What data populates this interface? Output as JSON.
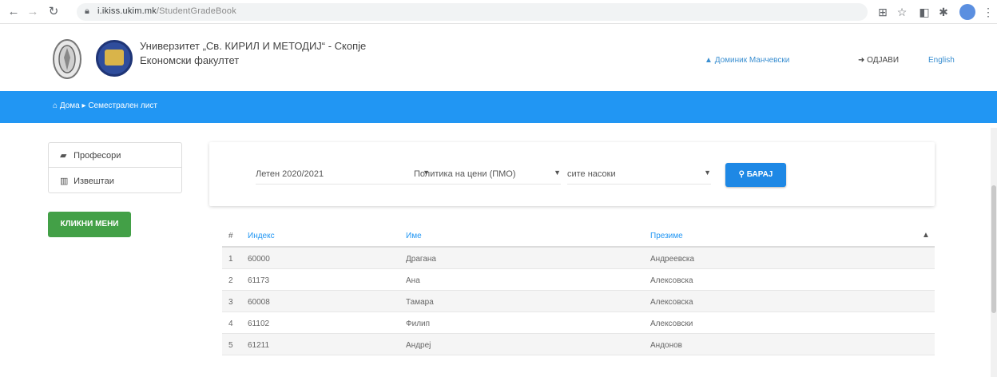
{
  "browser": {
    "url_host": "i.ikiss.ukim.mk",
    "url_path": "/StudentGradeBook"
  },
  "header": {
    "university": "Универзитет „Св. КИРИЛ И МЕТОДИЈ“ - Скопје",
    "faculty": "Економски факултет",
    "user": "Доминик Манчевски",
    "logout": "ОДЈАВИ",
    "language": "English"
  },
  "nav": {
    "home": "Дома",
    "current": "Семестрален лист"
  },
  "sidebar": {
    "items": [
      {
        "label": "Професори"
      },
      {
        "label": "Извештаи"
      }
    ],
    "green_button": "КЛИКНИ МЕНИ"
  },
  "filters": {
    "year": "Летен 2020/2021",
    "subject": "Политика на цени (ПМО)",
    "direction": "сите насоки",
    "search_button": "БАРАЈ"
  },
  "table": {
    "headers": {
      "num": "#",
      "index": "Индекс",
      "name": "Име",
      "surname": "Презиме"
    },
    "rows": [
      {
        "num": "1",
        "index": "60000",
        "name": "Драгана",
        "surname": "Андреевска"
      },
      {
        "num": "2",
        "index": "61173",
        "name": "Ана",
        "surname": "Алексовска"
      },
      {
        "num": "3",
        "index": "60008",
        "name": "Тамара",
        "surname": "Алексовска"
      },
      {
        "num": "4",
        "index": "61102",
        "name": "Филип",
        "surname": "Алексовски"
      },
      {
        "num": "5",
        "index": "61211",
        "name": "Андреј",
        "surname": "Андонов"
      }
    ]
  }
}
